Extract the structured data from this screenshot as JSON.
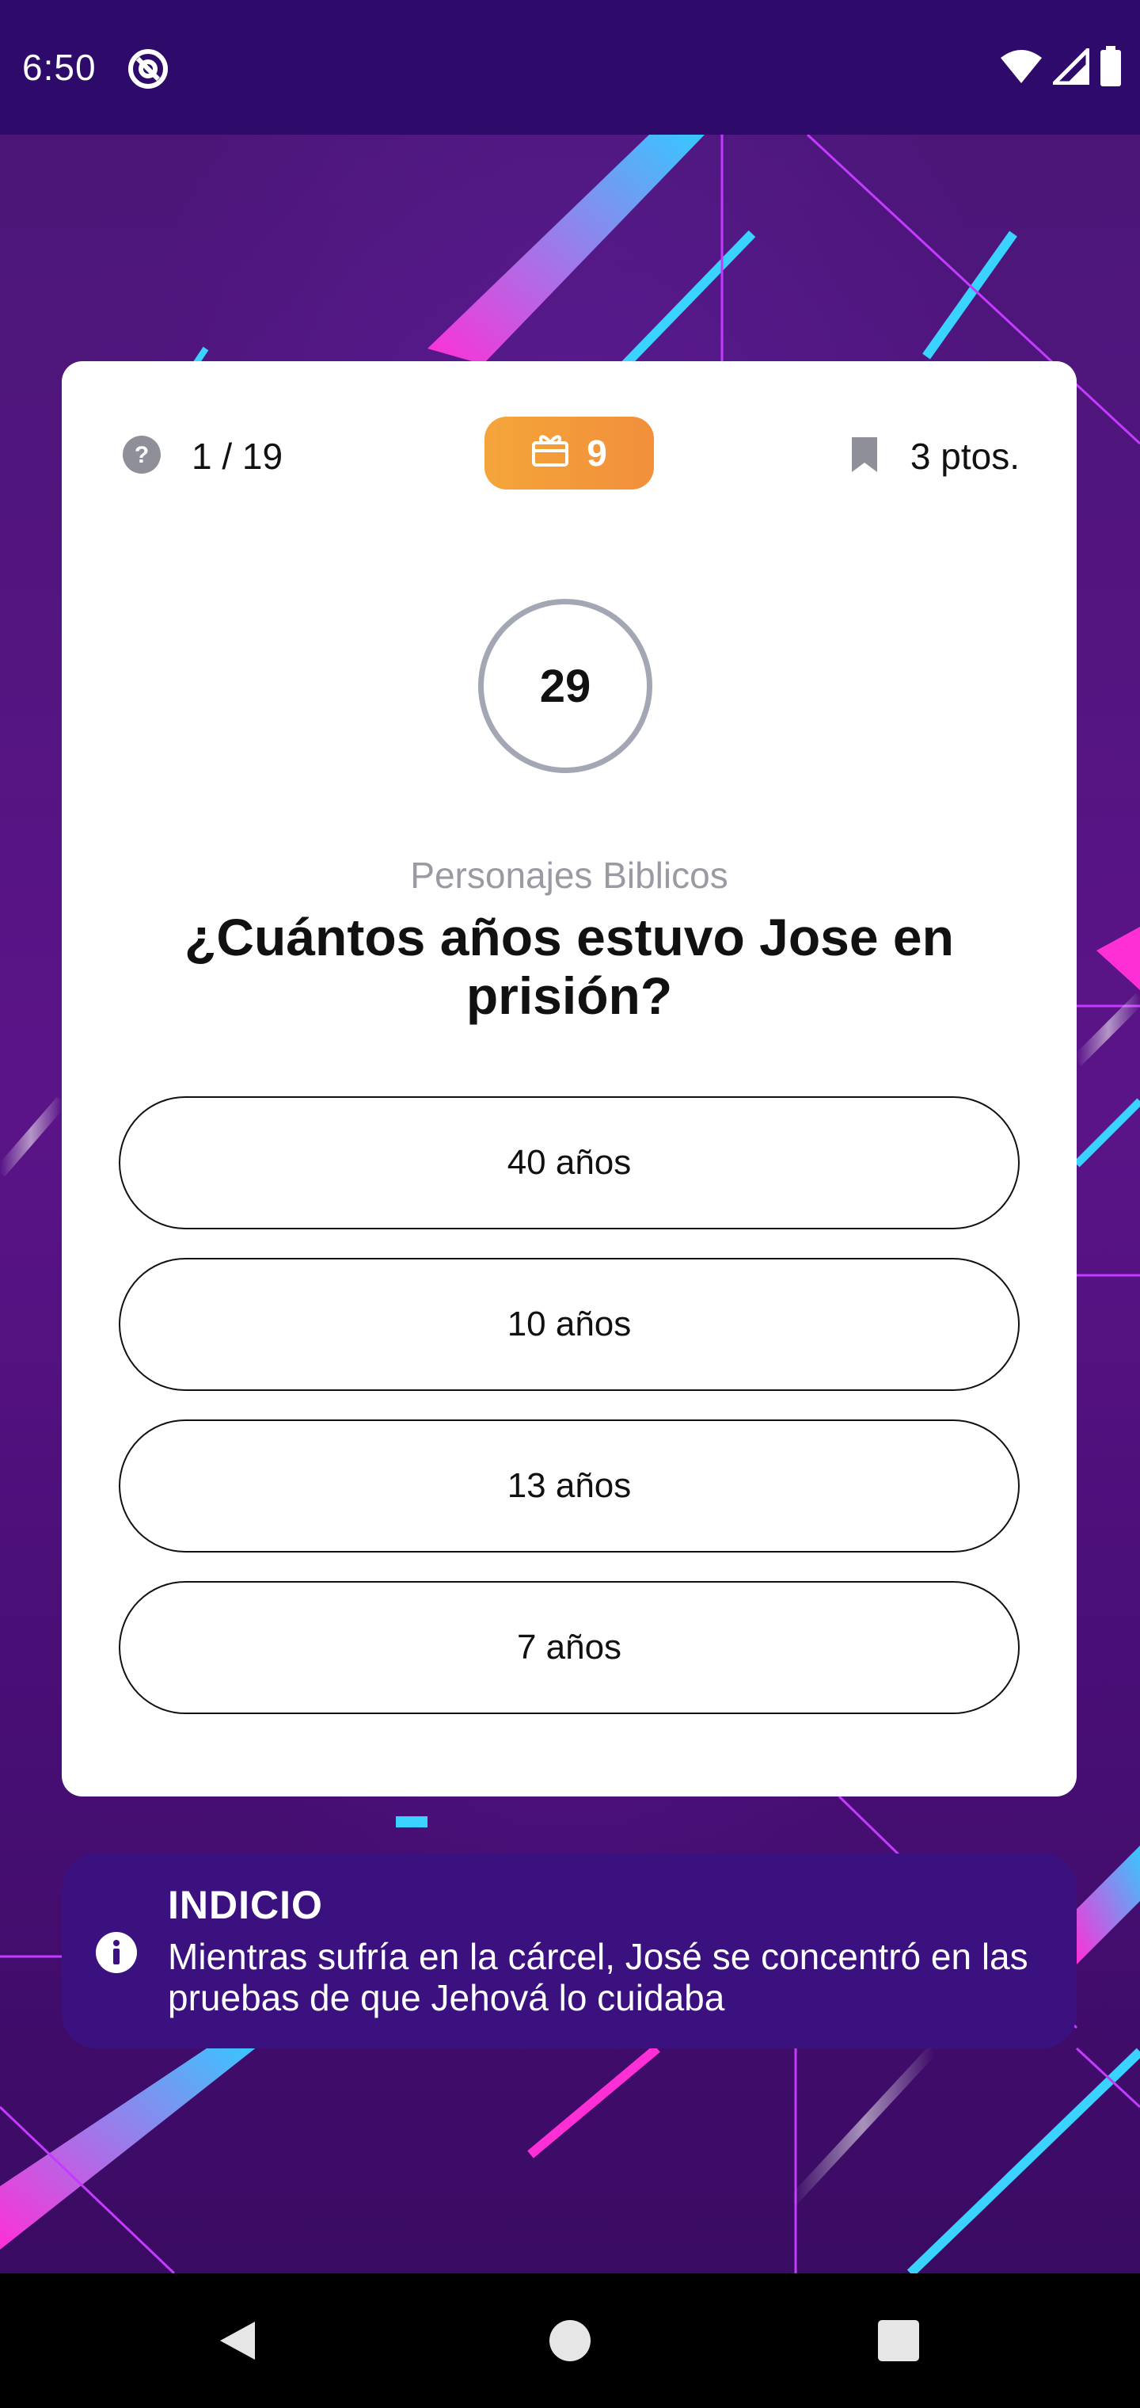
{
  "status_bar": {
    "time": "6:50",
    "icons": [
      "at-sign-icon",
      "wifi-icon",
      "signal-icon",
      "battery-icon"
    ]
  },
  "quiz": {
    "question_counter": "1 / 19",
    "gift_count": "9",
    "points": "3 ptos.",
    "timer": "29",
    "category": "Personajes Biblicos",
    "question": "¿Cuántos años estuvo Jose en prisión?",
    "answers": [
      {
        "label": "40 años"
      },
      {
        "label": "10 años"
      },
      {
        "label": "13 años"
      },
      {
        "label": "7 años"
      }
    ]
  },
  "hint": {
    "title": "INDICIO",
    "text": "Mientras sufría en la cárcel, José se concentró en las pruebas de que Jehová lo cuidaba"
  },
  "colors": {
    "accent_orange": "#f4a53a",
    "status_bar": "#2e0a6a",
    "hint_background": "#3a117e"
  }
}
